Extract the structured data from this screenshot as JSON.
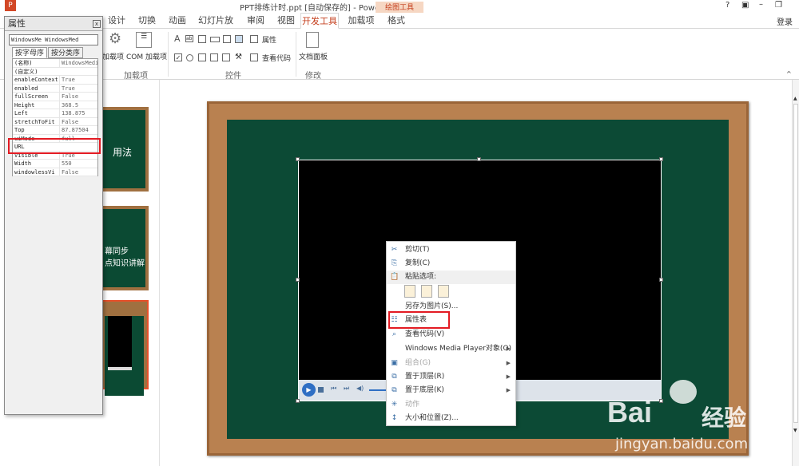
{
  "window": {
    "title": "PPT排练计时.ppt [自动保存的] - PowerPoint",
    "context_tab_group": "绘图工具",
    "controls": [
      "?",
      "▣",
      "–",
      "❐"
    ],
    "sign_in": "登录"
  },
  "tabs": [
    "设计",
    "切换",
    "动画",
    "幻灯片放映",
    "审阅",
    "视图",
    "开发工具",
    "加载项",
    "格式"
  ],
  "ribbon": {
    "addins_label": "加载项",
    "com_addins_label": "COM 加载项",
    "group_addins": "加载项",
    "group_controls": "控件",
    "properties_label": "属性",
    "view_code_label": "查看代码",
    "doc_panel_label": "文档面板",
    "group_modify": "修改"
  },
  "props": {
    "title": "属性",
    "combo": "WindowsMe WindowsMed",
    "tab_alpha": "按字母序",
    "tab_cat": "按分类序",
    "rows": [
      {
        "k": "(名称)",
        "v": "WindowsMedi"
      },
      {
        "k": "(自定义)",
        "v": ""
      },
      {
        "k": "enableContext",
        "v": "True"
      },
      {
        "k": "enabled",
        "v": "True"
      },
      {
        "k": "fullScreen",
        "v": "False"
      },
      {
        "k": "Height",
        "v": "368.5"
      },
      {
        "k": "Left",
        "v": "138.875"
      },
      {
        "k": "stretchToFit",
        "v": "False"
      },
      {
        "k": "Top",
        "v": "87.87504"
      },
      {
        "k": "uiMode",
        "v": "full"
      },
      {
        "k": "URL",
        "v": ""
      },
      {
        "k": "Visible",
        "v": "True"
      },
      {
        "k": "Width",
        "v": "550"
      },
      {
        "k": "windowlessVi",
        "v": "False"
      }
    ]
  },
  "slides": [
    {
      "text": "用法"
    },
    {
      "text": "幕同步\n点知识讲解"
    },
    {
      "text": ""
    }
  ],
  "menu": [
    {
      "label": "剪切(T)",
      "icon": "✂",
      "dis": false
    },
    {
      "label": "复制(C)",
      "icon": "⎘",
      "dis": false
    },
    {
      "label": "粘贴选项:",
      "icon": "📋",
      "dis": false
    },
    {
      "label": "",
      "icon": "",
      "dis": false
    },
    {
      "label": "另存为图片(S)...",
      "icon": "",
      "dis": false
    },
    {
      "label": "属性表",
      "icon": "☷",
      "dis": false
    },
    {
      "label": "查看代码(V)",
      "icon": "⌕",
      "dis": false
    },
    {
      "label": "Windows Media Player对象(O)",
      "icon": "",
      "dis": false,
      "sub": true
    },
    {
      "label": "组合(G)",
      "icon": "▣",
      "dis": true,
      "sub": true
    },
    {
      "label": "置于顶层(R)",
      "icon": "⧉",
      "dis": false,
      "sub": true
    },
    {
      "label": "置于底层(K)",
      "icon": "⧉",
      "dis": false,
      "sub": true
    },
    {
      "label": "动作",
      "icon": "✳",
      "dis": true
    },
    {
      "label": "大小和位置(Z)...",
      "icon": "↕",
      "dis": false
    }
  ],
  "watermark": {
    "brand": "Bai",
    "brand2": "经验",
    "url": "jingyan.baidu.com"
  }
}
